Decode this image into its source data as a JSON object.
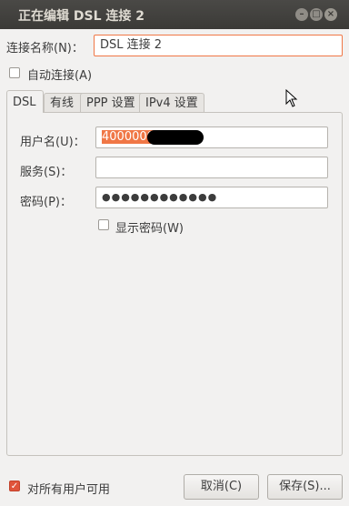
{
  "window": {
    "title": "正在编辑 DSL 连接 2",
    "min_glyph": "–",
    "max_glyph": "□",
    "close_glyph": "×"
  },
  "connection_name": {
    "label": "连接名称(N)：",
    "value": "DSL 连接 2"
  },
  "auto_connect": {
    "label": "自动连接(A)",
    "checked": false
  },
  "tabs": [
    {
      "label": "DSL",
      "active": true
    },
    {
      "label": "有线",
      "active": false
    },
    {
      "label": "PPP 设置",
      "active": false
    },
    {
      "label": "IPv4 设置",
      "active": false
    }
  ],
  "dsl": {
    "username_label": "用户名(U)：",
    "username_value": "4000000",
    "service_label": "服务(S)：",
    "service_value": "",
    "password_label": "密码(P)：",
    "password_value": "●●●●●●●●●●●●",
    "show_password_label": "显示密码(W)",
    "show_password_checked": false
  },
  "footer": {
    "all_users_label": "对所有用户可用",
    "all_users_checked": true,
    "cancel_label": "取消(C)",
    "save_label": "保存(S)..."
  },
  "colors": {
    "accent": "#f07746",
    "titlebar": "#3b3a37"
  }
}
